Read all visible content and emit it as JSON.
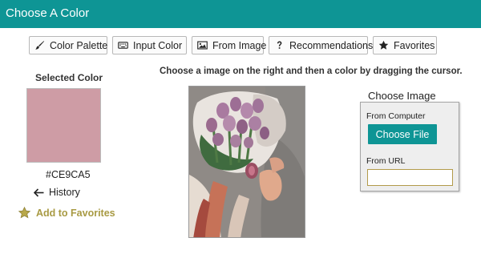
{
  "app": {
    "title": "Choose A Color",
    "accent": "#0e9595"
  },
  "tabs": [
    {
      "label": "Color Palette",
      "icon": "paintbrush-icon"
    },
    {
      "label": "Input Color",
      "icon": "keyboard-icon"
    },
    {
      "label": "From Image",
      "icon": "image-icon"
    },
    {
      "label": "Recommendations",
      "icon": "question-icon"
    },
    {
      "label": "Favorites",
      "icon": "star-icon"
    }
  ],
  "selected": {
    "label": "Selected Color",
    "hex": "#CE9CA5",
    "color": "#ce9ca5"
  },
  "links": {
    "history": "History",
    "add_favorites": "Add to Favorites"
  },
  "instruction": "Choose a image on the right and then a color by dragging the cursor.",
  "image_panel": {
    "title": "Choose Image",
    "from_computer": "From Computer",
    "choose_file": "Choose File",
    "from_url": "From URL",
    "url_value": ""
  }
}
